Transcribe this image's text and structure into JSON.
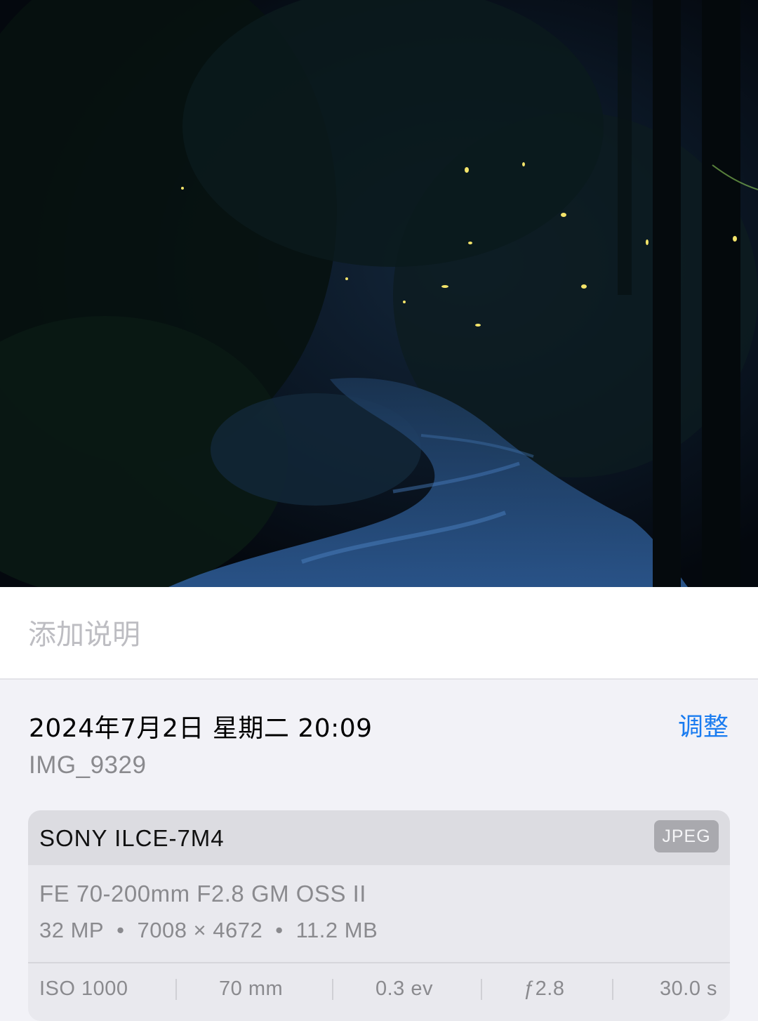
{
  "photo": {
    "subject": "Fireflies over a stone path in a dark forest at night"
  },
  "caption": {
    "placeholder": "添加说明"
  },
  "info": {
    "datetime": "2024年7月2日 星期二 20:09",
    "adjust_label": "调整",
    "filename": "IMG_9329"
  },
  "camera": {
    "model": "SONY ILCE-7M4",
    "format": "JPEG",
    "lens": "FE 70-200mm F2.8 GM OSS II",
    "megapixels": "32 MP",
    "resolution": "7008 × 4672",
    "filesize": "11.2 MB",
    "separator": "•"
  },
  "exif": {
    "iso": "ISO 1000",
    "focal_length": "70 mm",
    "exposure_bias": "0.3 ev",
    "aperture": "ƒ2.8",
    "shutter": "30.0 s"
  },
  "colors": {
    "accent": "#1a7cf0",
    "secondary_text": "#8a8a8e",
    "firefly": "#f4e46a"
  }
}
